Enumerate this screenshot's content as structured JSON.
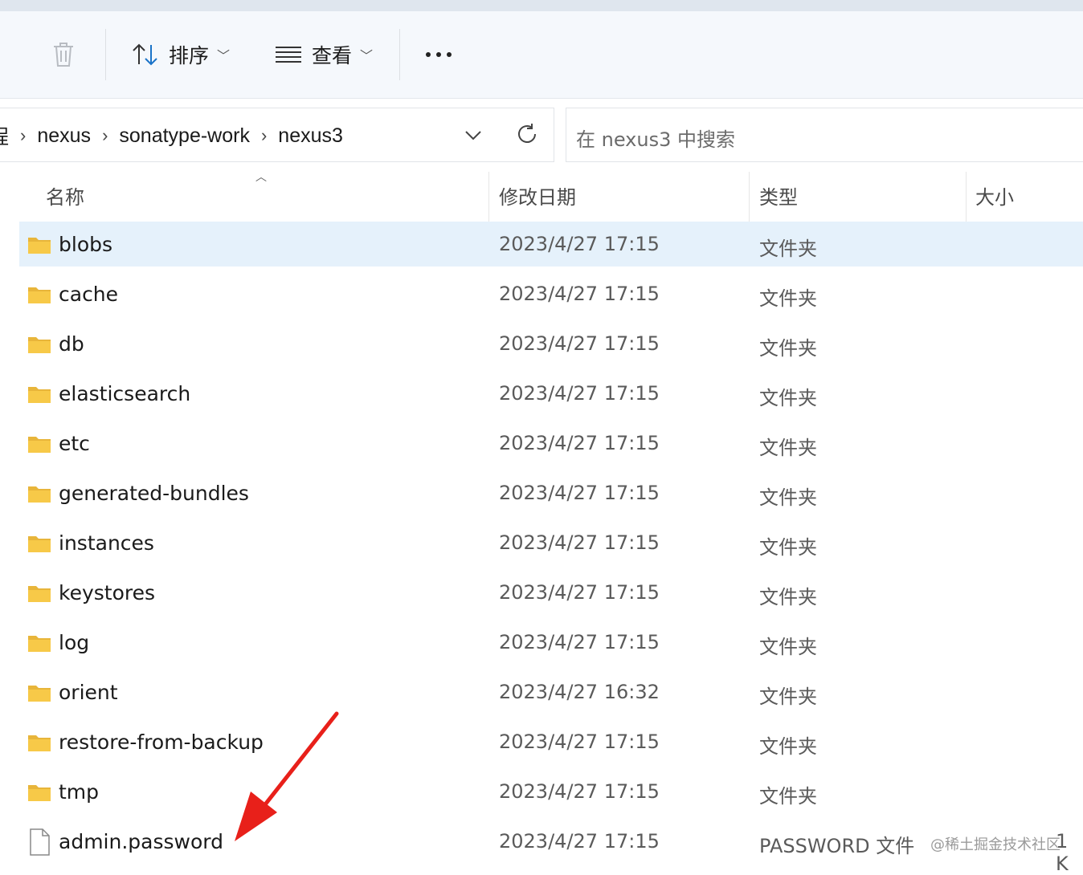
{
  "toolbar": {
    "sort_label": "排序",
    "view_label": "查看"
  },
  "address": {
    "partial_crumb": "程",
    "crumbs": [
      "nexus",
      "sonatype-work",
      "nexus3"
    ]
  },
  "search": {
    "placeholder": "在 nexus3 中搜索"
  },
  "columns": {
    "name": "名称",
    "date": "修改日期",
    "type": "类型",
    "size": "大小"
  },
  "files": [
    {
      "name": "blobs",
      "date": "2023/4/27 17:15",
      "type": "文件夹",
      "size": "",
      "kind": "folder"
    },
    {
      "name": "cache",
      "date": "2023/4/27 17:15",
      "type": "文件夹",
      "size": "",
      "kind": "folder"
    },
    {
      "name": "db",
      "date": "2023/4/27 17:15",
      "type": "文件夹",
      "size": "",
      "kind": "folder"
    },
    {
      "name": "elasticsearch",
      "date": "2023/4/27 17:15",
      "type": "文件夹",
      "size": "",
      "kind": "folder"
    },
    {
      "name": "etc",
      "date": "2023/4/27 17:15",
      "type": "文件夹",
      "size": "",
      "kind": "folder"
    },
    {
      "name": "generated-bundles",
      "date": "2023/4/27 17:15",
      "type": "文件夹",
      "size": "",
      "kind": "folder"
    },
    {
      "name": "instances",
      "date": "2023/4/27 17:15",
      "type": "文件夹",
      "size": "",
      "kind": "folder"
    },
    {
      "name": "keystores",
      "date": "2023/4/27 17:15",
      "type": "文件夹",
      "size": "",
      "kind": "folder"
    },
    {
      "name": "log",
      "date": "2023/4/27 17:15",
      "type": "文件夹",
      "size": "",
      "kind": "folder"
    },
    {
      "name": "orient",
      "date": "2023/4/27 16:32",
      "type": "文件夹",
      "size": "",
      "kind": "folder"
    },
    {
      "name": "restore-from-backup",
      "date": "2023/4/27 17:15",
      "type": "文件夹",
      "size": "",
      "kind": "folder"
    },
    {
      "name": "tmp",
      "date": "2023/4/27 17:15",
      "type": "文件夹",
      "size": "",
      "kind": "folder"
    },
    {
      "name": "admin.password",
      "date": "2023/4/27 17:15",
      "type": "PASSWORD 文件",
      "size": "1 K",
      "kind": "file"
    }
  ],
  "watermark": "@稀土掘金技术社区",
  "colors": {
    "selected_row": "#e5f1fb",
    "folder": "#f7c948",
    "annotation_arrow": "#e8201a"
  }
}
